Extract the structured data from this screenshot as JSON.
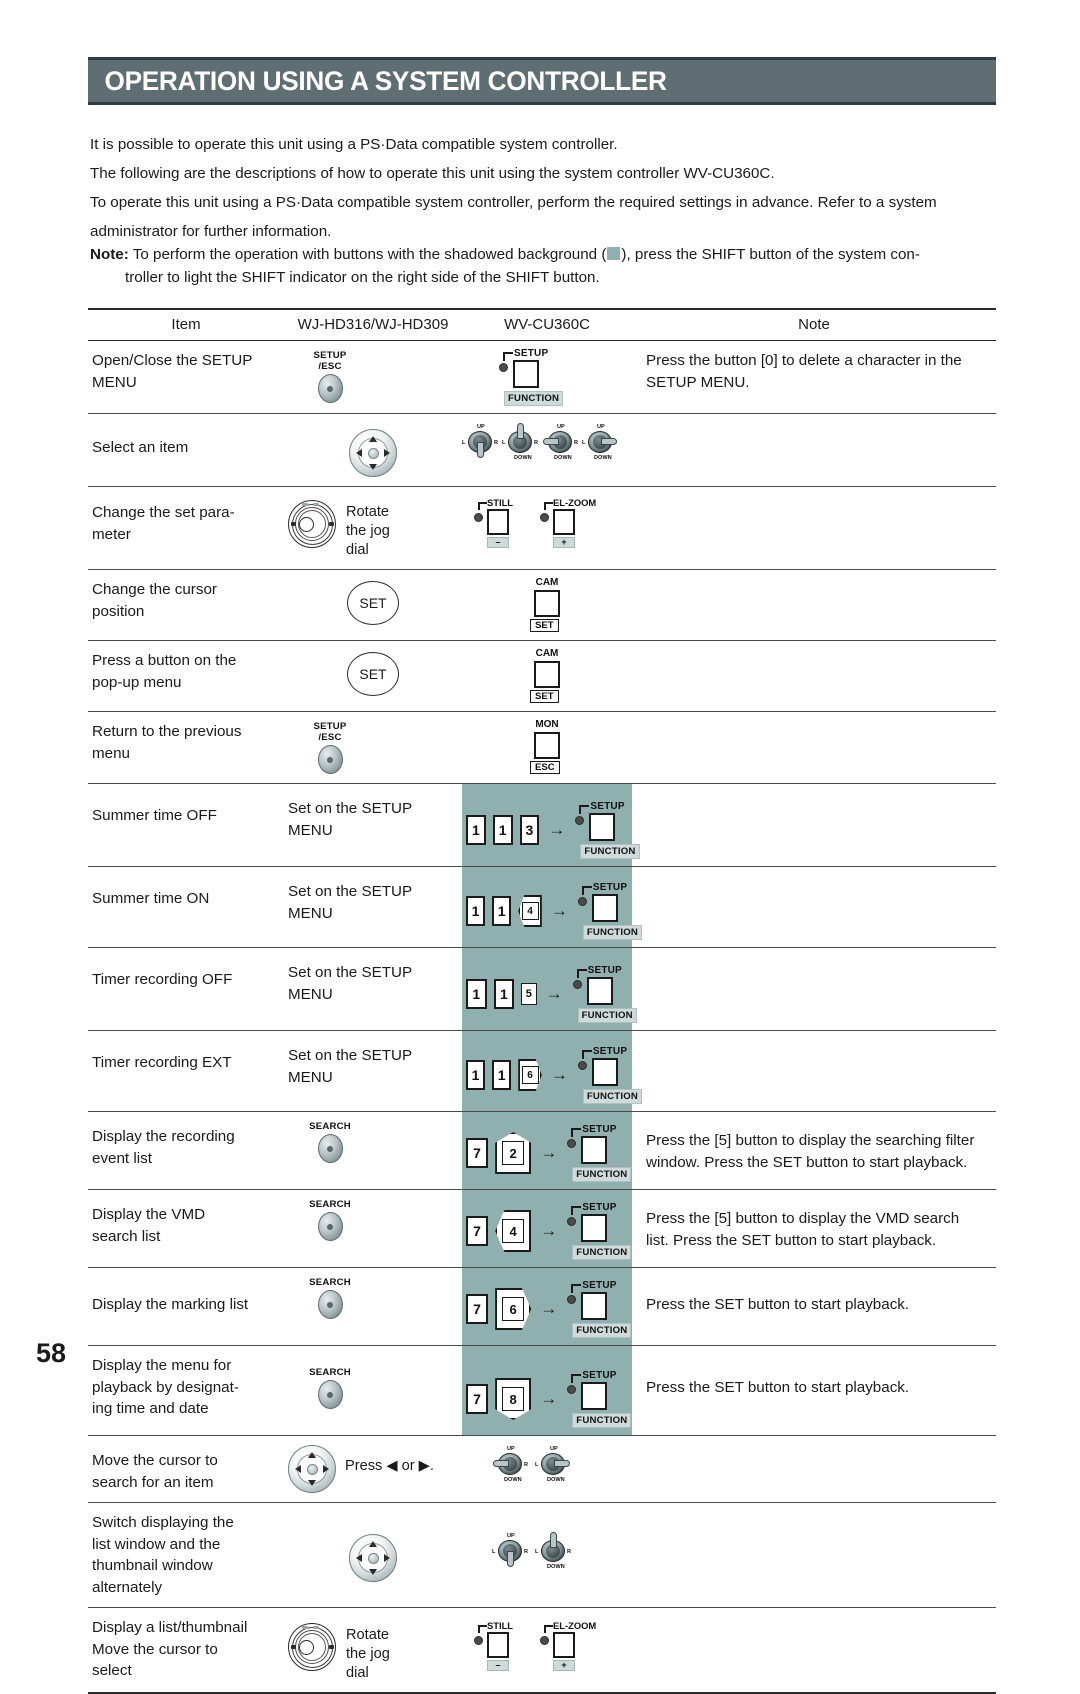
{
  "header": {
    "title": "OPERATION USING A SYSTEM CONTROLLER",
    "bg_color": "#5f6e72"
  },
  "intro": {
    "p1": "It is possible to operate this unit using a PS·Data compatible system controller.",
    "p2": "The following are the descriptions of how to operate this unit using the system controller WV-CU360C.",
    "p3": "To operate this unit using a PS·Data compatible system controller, perform the required settings in advance. Refer to a system",
    "p4": "administrator for further information."
  },
  "note": {
    "label": "Note:",
    "line1_a": "To perform the operation with buttons with the shadowed background (",
    "line1_b": "), press the SHIFT button of the system con-",
    "line2": "troller to light the SHIFT indicator on the right side of the SHIFT button.",
    "shade_color": "#8fb0ae"
  },
  "table": {
    "headers": {
      "item": "Item",
      "hd": "WJ-HD316/WJ-HD309",
      "cu": "WV-CU360C",
      "note": "Note"
    },
    "rows": [
      {
        "item_l1": "Open/Close the SETUP",
        "item_l2": "MENU",
        "hd_btn_label_l1": "SETUP",
        "hd_btn_label_l2": "/ESC",
        "cu_top": "SETUP",
        "cu_bottom": "FUNCTION",
        "note_l1": "Press the button [0] to delete a character in the",
        "note_l2": "SETUP MENU."
      },
      {
        "item_l1": "Select an item",
        "item_l2": "",
        "joy_up": "UP",
        "joy_down": "DOWN",
        "joy_left": "L",
        "joy_right": "R"
      },
      {
        "item_l1": "Change the set para-",
        "item_l2": "meter",
        "jog_l1": "Rotate",
        "jog_l2": "the jog",
        "jog_l3": "dial",
        "pm1_label": "STILL",
        "pm1_sign": "–",
        "pm2_label": "EL-ZOOM",
        "pm2_sign": "+"
      },
      {
        "item_l1": "Change the cursor",
        "item_l2": "position",
        "hd_set": "SET",
        "cu_top": "CAM",
        "cu_bottom": "SET"
      },
      {
        "item_l1": "Press a button on the",
        "item_l2": "pop-up menu",
        "hd_set": "SET",
        "cu_top": "CAM",
        "cu_bottom": "SET"
      },
      {
        "item_l1": "Return to the previous",
        "item_l2": "menu",
        "hd_btn_label_l1": "SETUP",
        "hd_btn_label_l2": "/ESC",
        "cu_top": "MON",
        "cu_bottom": "ESC"
      },
      {
        "item_l1": "Summer time OFF",
        "item_l2": "",
        "hd_l1": "Set on the SETUP",
        "hd_l2": "MENU",
        "keys": [
          "1",
          "1",
          "3"
        ],
        "cu_top": "SETUP",
        "cu_bottom": "FUNCTION",
        "shaded": true
      },
      {
        "item_l1": "Summer time ON",
        "item_l2": "",
        "hd_l1": "Set on the SETUP",
        "hd_l2": "MENU",
        "keys": [
          "1",
          "1",
          "4"
        ],
        "cu_top": "SETUP",
        "cu_bottom": "FUNCTION",
        "shaded": true
      },
      {
        "item_l1": "Timer recording OFF",
        "item_l2": "",
        "hd_l1": "Set on the SETUP",
        "hd_l2": "MENU",
        "keys": [
          "1",
          "1",
          "5"
        ],
        "cu_top": "SETUP",
        "cu_bottom": "FUNCTION",
        "shaded": true
      },
      {
        "item_l1": "Timer recording EXT",
        "item_l2": "",
        "hd_l1": "Set on the SETUP",
        "hd_l2": "MENU",
        "keys": [
          "1",
          "1",
          "6"
        ],
        "cu_top": "SETUP",
        "cu_bottom": "FUNCTION",
        "shaded": true
      },
      {
        "item_l1": "Display the recording",
        "item_l2": "event list",
        "hd_btn_label_l1": "SEARCH",
        "hd_btn_label_l2": "",
        "keys": [
          "7",
          "2"
        ],
        "cu_top": "SETUP",
        "cu_bottom": "FUNCTION",
        "note_l1": "Press the [5] button to display the searching filter",
        "note_l2": "window. Press the SET button to start playback.",
        "shaded": true
      },
      {
        "item_l1": "Display the VMD",
        "item_l2": "search list",
        "hd_btn_label_l1": "SEARCH",
        "hd_btn_label_l2": "",
        "keys": [
          "7",
          "4"
        ],
        "cu_top": "SETUP",
        "cu_bottom": "FUNCTION",
        "note_l1": "Press the [5] button to display the VMD search",
        "note_l2": "list. Press the SET button to start playback.",
        "shaded": true
      },
      {
        "item_l1": "Display the marking list",
        "item_l2": "",
        "hd_btn_label_l1": "SEARCH",
        "hd_btn_label_l2": "",
        "keys": [
          "7",
          "6"
        ],
        "cu_top": "SETUP",
        "cu_bottom": "FUNCTION",
        "note_l1": "Press the SET button to start playback.",
        "note_l2": "",
        "shaded": true
      },
      {
        "item_l1": "Display the menu for",
        "item_l2": "playback by designat-",
        "item_l3": "ing time and date",
        "hd_btn_label_l1": "SEARCH",
        "hd_btn_label_l2": "",
        "keys": [
          "7",
          "8"
        ],
        "cu_top": "SETUP",
        "cu_bottom": "FUNCTION",
        "note_l1": "Press the SET button to start playback.",
        "note_l2": "",
        "shaded": true
      },
      {
        "item_l1": "Move the cursor to",
        "item_l2": "search for an item",
        "press_text": "Press ◀ or ▶.",
        "joy_up": "UP",
        "joy_down": "DOWN",
        "joy_left": "L",
        "joy_right": "R"
      },
      {
        "item_l1": "Switch displaying the",
        "item_l2": "list window and the",
        "item_l3": "thumbnail window",
        "item_l4": "alternately",
        "joy_up": "UP",
        "joy_down": "DOWN",
        "joy_left": "L",
        "joy_right": "R"
      },
      {
        "item_l1": "Display a list/thumbnail",
        "item_l2": "Move the cursor to",
        "item_l3": "select",
        "jog_l1": "Rotate",
        "jog_l2": "the jog",
        "jog_l3": "dial",
        "pm1_label": "STILL",
        "pm1_sign": "–",
        "pm2_label": "EL-ZOOM",
        "pm2_sign": "+"
      }
    ]
  },
  "footer": {
    "page_number": "58"
  }
}
